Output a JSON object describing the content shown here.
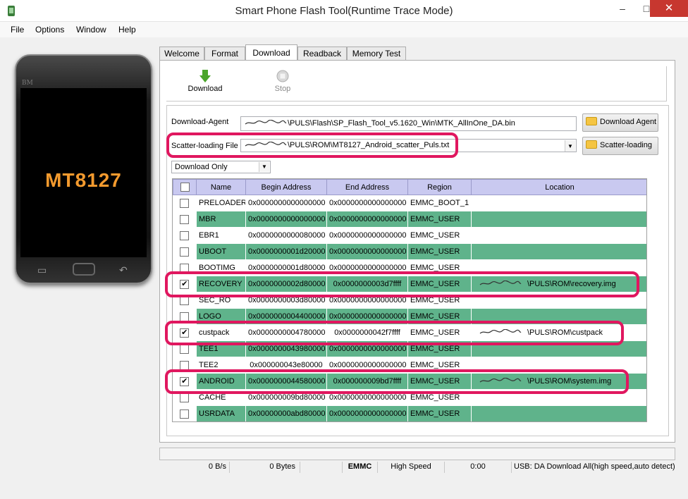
{
  "window": {
    "title": "Smart Phone Flash Tool(Runtime Trace Mode)",
    "minimize": "–",
    "maximize": "□",
    "close": "✕"
  },
  "menu": [
    {
      "label": "File"
    },
    {
      "label": "Options"
    },
    {
      "label": "Window"
    },
    {
      "label": "Help"
    }
  ],
  "phone": {
    "brand": "BM",
    "model": "MT8127"
  },
  "tabs": [
    {
      "label": "Welcome",
      "active": false
    },
    {
      "label": "Format",
      "active": false
    },
    {
      "label": "Download",
      "active": true
    },
    {
      "label": "Readback",
      "active": false
    },
    {
      "label": "Memory Test",
      "active": false
    }
  ],
  "toolbar": {
    "download_label": "Download",
    "stop_label": "Stop"
  },
  "form": {
    "download_agent_label": "Download-Agent",
    "download_agent_value": "\\PULS\\Flash\\SP_Flash_Tool_v5.1620_Win\\MTK_AllInOne_DA.bin",
    "download_agent_button": "Download Agent",
    "scatter_label": "Scatter-loading File",
    "scatter_value": "\\PULS\\ROM\\MT8127_Android_scatter_Puls.txt",
    "scatter_button": "Scatter-loading",
    "mode_value": "Download Only"
  },
  "table": {
    "headers": [
      "",
      "Name",
      "Begin Address",
      "End Address",
      "Region",
      "Location"
    ],
    "rows": [
      {
        "checked": false,
        "name": "PRELOADER",
        "begin": "0x0000000000000000",
        "end": "0x0000000000000000",
        "region": "EMMC_BOOT_1",
        "location": ""
      },
      {
        "checked": false,
        "name": "MBR",
        "begin": "0x0000000000000000",
        "end": "0x0000000000000000",
        "region": "EMMC_USER",
        "location": ""
      },
      {
        "checked": false,
        "name": "EBR1",
        "begin": "0x0000000000080000",
        "end": "0x0000000000000000",
        "region": "EMMC_USER",
        "location": ""
      },
      {
        "checked": false,
        "name": "UBOOT",
        "begin": "0x0000000001d20000",
        "end": "0x0000000000000000",
        "region": "EMMC_USER",
        "location": ""
      },
      {
        "checked": false,
        "name": "BOOTIMG",
        "begin": "0x0000000001d80000",
        "end": "0x0000000000000000",
        "region": "EMMC_USER",
        "location": ""
      },
      {
        "checked": true,
        "name": "RECOVERY",
        "begin": "0x0000000002d80000",
        "end": "0x0000000003d7ffff",
        "region": "EMMC_USER",
        "location": "\\PULS\\ROM\\recovery.img"
      },
      {
        "checked": false,
        "name": "SEC_RO",
        "begin": "0x0000000003d80000",
        "end": "0x0000000000000000",
        "region": "EMMC_USER",
        "location": ""
      },
      {
        "checked": false,
        "name": "LOGO",
        "begin": "0x0000000004400000",
        "end": "0x0000000000000000",
        "region": "EMMC_USER",
        "location": ""
      },
      {
        "checked": true,
        "name": "custpack",
        "begin": "0x0000000004780000",
        "end": "0x0000000042f7ffff",
        "region": "EMMC_USER",
        "location": "\\PULS\\ROM\\custpack"
      },
      {
        "checked": false,
        "name": "TEE1",
        "begin": "0x0000000043980000",
        "end": "0x0000000000000000",
        "region": "EMMC_USER",
        "location": ""
      },
      {
        "checked": false,
        "name": "TEE2",
        "begin": "0x000000043e80000",
        "end": "0x0000000000000000",
        "region": "EMMC_USER",
        "location": ""
      },
      {
        "checked": true,
        "name": "ANDROID",
        "begin": "0x0000000044580000",
        "end": "0x000000009bd7ffff",
        "region": "EMMC_USER",
        "location": "\\PULS\\ROM\\system.img"
      },
      {
        "checked": false,
        "name": "CACHE",
        "begin": "0x000000009bd80000",
        "end": "0x0000000000000000",
        "region": "EMMC_USER",
        "location": ""
      },
      {
        "checked": false,
        "name": "USRDATA",
        "begin": "0x00000000abd80000",
        "end": "0x0000000000000000",
        "region": "EMMC_USER",
        "location": ""
      }
    ]
  },
  "status": {
    "speed": "0 B/s",
    "bytes": "0 Bytes",
    "storage": "EMMC",
    "mode": "High Speed",
    "time": "0:00",
    "message": "USB: DA Download All(high speed,auto detect)"
  },
  "colors": {
    "row_green": "#5fb38b",
    "header_lavender": "#c9c9f0",
    "highlight": "#e0175f",
    "phone_model_orange": "#f39a2e"
  }
}
